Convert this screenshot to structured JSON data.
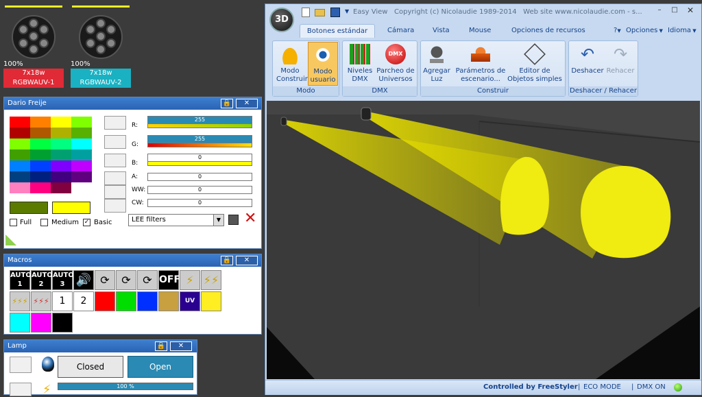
{
  "fixtures": [
    {
      "pct": "100%",
      "line1": "7x18w",
      "line2": "RGBWAUV-1",
      "color": "#e02a36"
    },
    {
      "pct": "100%",
      "line1": "7x18w",
      "line2": "RGBWAUV-2",
      "color": "#1ab1c2"
    }
  ],
  "color_panel": {
    "title": "Dario Freije",
    "sliders": [
      {
        "label": "R:",
        "value": "255"
      },
      {
        "label": "G:",
        "value": "255"
      },
      {
        "label": "B:",
        "value": "0"
      },
      {
        "label": "A:",
        "value": "0"
      },
      {
        "label": "WW:",
        "value": "0"
      },
      {
        "label": "CW:",
        "value": "0"
      }
    ],
    "check_full": "Full",
    "check_medium": "Medium",
    "check_basic": "Basic",
    "filter_value": "LEE filters",
    "color_a": "#5a7a00",
    "color_b": "#ffff00"
  },
  "macros_panel": {
    "title": "Macros",
    "auto1": "AUTO 1",
    "auto2": "AUTO 2",
    "auto3": "AUTO 3",
    "off": "OFF",
    "num1": "1",
    "num2": "2",
    "uv": "UV"
  },
  "lamp_panel": {
    "title": "Lamp",
    "closed": "Closed",
    "open": "Open",
    "progress": "100 %"
  },
  "app": {
    "title": "Easy View   Copyright (c) Nicolaudie 1989-2014   Web site www.nicolaudie.com - s...",
    "logo": "3D",
    "tabs": [
      "Botones estándar",
      "Cámara",
      "Vista",
      "Mouse",
      "Opciones de recursos"
    ],
    "right_menu": [
      "Opciones",
      "Idioma"
    ],
    "help": "?",
    "groups": [
      {
        "label": "Modo",
        "buttons": [
          "Modo Construir",
          "Modo usuario"
        ]
      },
      {
        "label": "DMX",
        "buttons": [
          "Niveles DMX",
          "Parcheo de Universos"
        ]
      },
      {
        "label": "Construir",
        "buttons": [
          "Agregar Luz",
          "Parámetros de escenario...",
          "Editor de Objetos simples"
        ]
      },
      {
        "label": "Deshacer / Rehacer",
        "buttons": [
          "Deshacer",
          "Rehacer"
        ]
      }
    ],
    "status": [
      "Controlled by FreeStyler",
      "ECO MODE",
      "DMX ON"
    ]
  }
}
